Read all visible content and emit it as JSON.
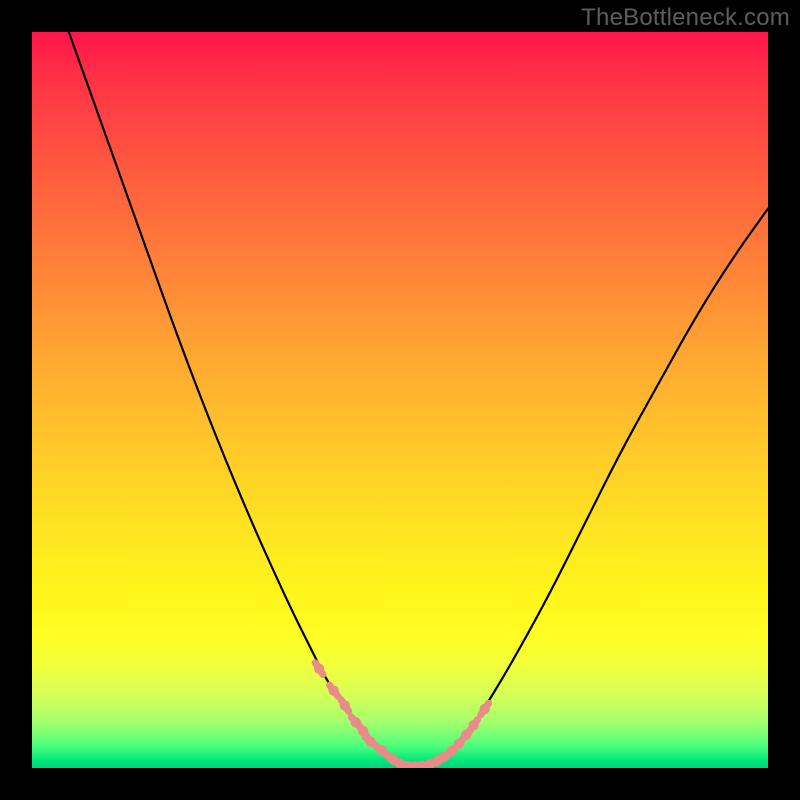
{
  "watermark": "TheBottleneck.com",
  "colors": {
    "frame_bg": "#000000",
    "gradient_top": "#ff154a",
    "gradient_bottom": "#00d47a",
    "curve": "#000000",
    "marker": "#e88c88"
  },
  "chart_data": {
    "type": "line",
    "title": "",
    "xlabel": "",
    "ylabel": "",
    "xlim": [
      0,
      100
    ],
    "ylim": [
      0,
      100
    ],
    "grid": false,
    "legend": false,
    "series": [
      {
        "name": "bottleneck-curve",
        "note": "y≈0 optimal; y increases toward red",
        "x": [
          5,
          10,
          15,
          20,
          25,
          30,
          35,
          38,
          40,
          42,
          44,
          46,
          48,
          50,
          52,
          54,
          56,
          58,
          60,
          62,
          65,
          70,
          75,
          80,
          85,
          90,
          95,
          100
        ],
        "y": [
          100,
          86,
          72,
          58,
          45,
          33,
          22,
          16,
          12,
          9,
          6,
          3.5,
          1.8,
          0.6,
          0.2,
          0.5,
          1.5,
          3.2,
          5.8,
          9,
          14,
          23,
          33,
          43,
          52,
          61,
          69,
          76
        ]
      }
    ],
    "markers": {
      "name": "highlighted-points",
      "color": "#e88c88",
      "x": [
        39,
        41,
        42.5,
        44,
        45,
        46,
        47.5,
        49,
        50,
        51,
        52,
        53,
        54,
        55,
        56,
        57,
        58,
        59,
        60,
        61.5
      ],
      "y": [
        13.5,
        10.5,
        8.5,
        6.2,
        5.0,
        3.6,
        2.4,
        1.2,
        0.6,
        0.3,
        0.2,
        0.3,
        0.5,
        0.9,
        1.5,
        2.3,
        3.3,
        4.5,
        5.8,
        8.0
      ]
    },
    "annotations": []
  }
}
